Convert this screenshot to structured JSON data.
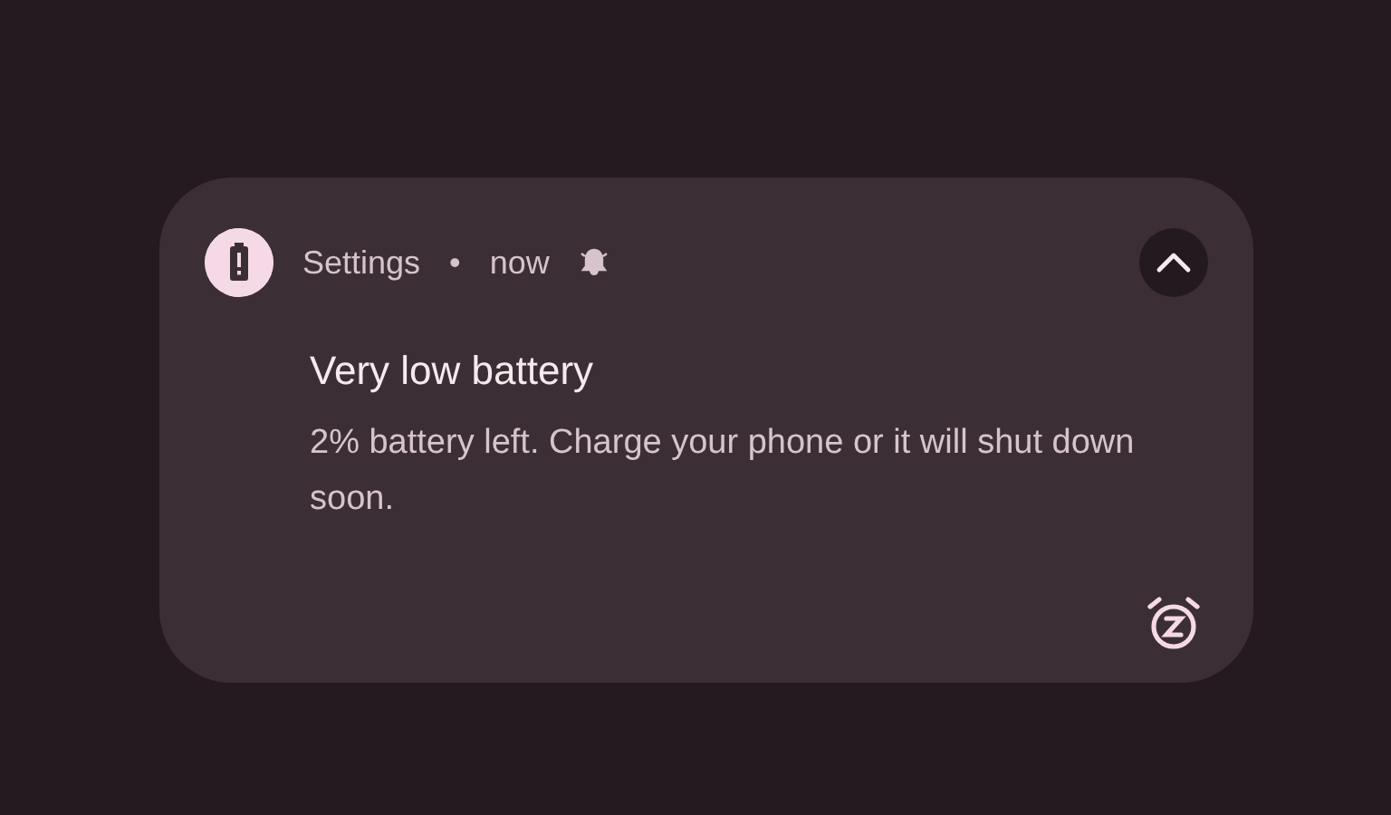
{
  "notification": {
    "app_name": "Settings",
    "separator": "•",
    "time": "now",
    "title": "Very low battery",
    "text": "2% battery left. Charge your phone or it will shut down soon.",
    "expanded": true
  }
}
